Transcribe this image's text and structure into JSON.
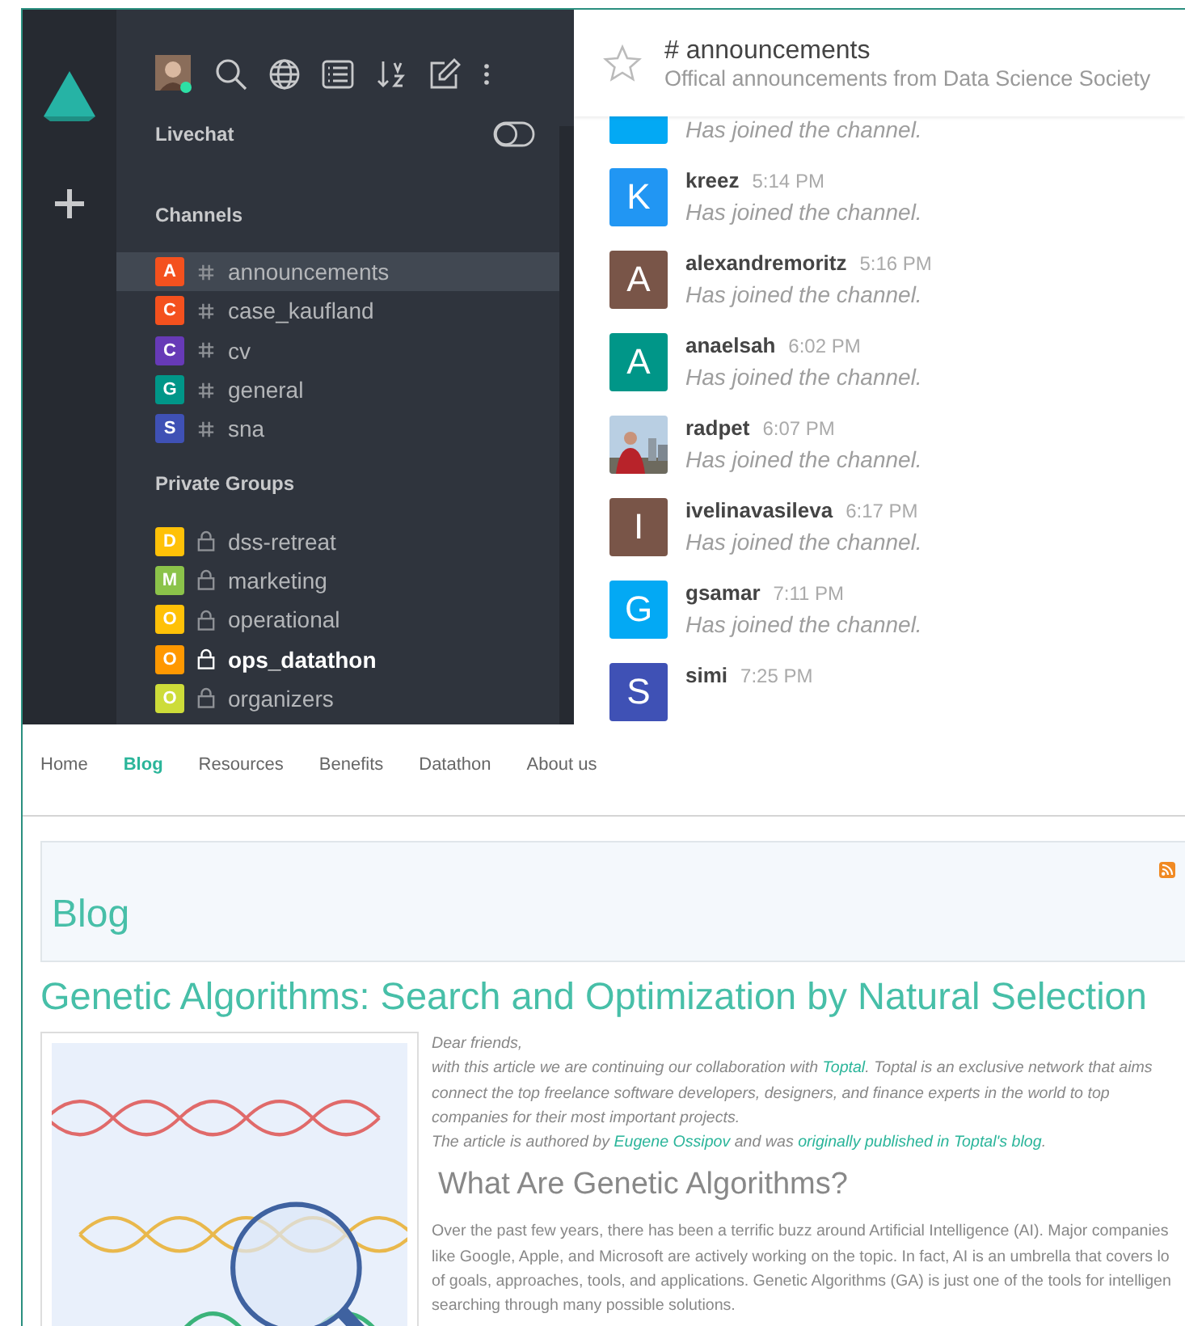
{
  "sidebar": {
    "livechat": {
      "label": "Livechat",
      "on": false
    },
    "sections": [
      {
        "title": "Channels",
        "kind": "channel",
        "items": [
          {
            "badge": "A",
            "name": "announcements",
            "color": "#f4511e",
            "selected": true,
            "unread": false
          },
          {
            "badge": "C",
            "name": "case_kaufland",
            "color": "#f4511e",
            "selected": false,
            "unread": false
          },
          {
            "badge": "C",
            "name": "cv",
            "color": "#673ab7",
            "selected": false,
            "unread": false
          },
          {
            "badge": "G",
            "name": "general",
            "color": "#009688",
            "selected": false,
            "unread": false
          },
          {
            "badge": "S",
            "name": "sna",
            "color": "#3f51b5",
            "selected": false,
            "unread": false
          }
        ]
      },
      {
        "title": "Private Groups",
        "kind": "private",
        "items": [
          {
            "badge": "D",
            "name": "dss-retreat",
            "color": "#ffc107",
            "selected": false,
            "unread": false
          },
          {
            "badge": "M",
            "name": "marketing",
            "color": "#8bc34a",
            "selected": false,
            "unread": false
          },
          {
            "badge": "O",
            "name": "operational",
            "color": "#ffc107",
            "selected": false,
            "unread": false
          },
          {
            "badge": "O",
            "name": "ops_datathon",
            "color": "#ff9800",
            "selected": false,
            "unread": true
          },
          {
            "badge": "O",
            "name": "organizers",
            "color": "#cddc39",
            "selected": false,
            "unread": false
          }
        ]
      }
    ]
  },
  "header": {
    "title": "# announcements",
    "topic": "Offical announcements from Data Science Society",
    "starred": false
  },
  "messages": [
    {
      "kind": "letter",
      "color": "#03a9f4",
      "text": "Has joined the channel."
    },
    {
      "kind": "letter",
      "initial": "K",
      "color": "#2196f3",
      "name": "kreez",
      "time": "5:14 PM",
      "text": "Has joined the channel."
    },
    {
      "kind": "letter",
      "initial": "A",
      "color": "#795548",
      "name": "alexandremoritz",
      "time": "5:16 PM",
      "text": "Has joined the channel."
    },
    {
      "kind": "letter",
      "initial": "A",
      "color": "#009688",
      "name": "anaelsah",
      "time": "6:02 PM",
      "text": "Has joined the channel."
    },
    {
      "kind": "picture",
      "name": "radpet",
      "time": "6:07 PM",
      "text": "Has joined the channel."
    },
    {
      "kind": "letter",
      "initial": "I",
      "color": "#795548",
      "name": "ivelinavasileva",
      "time": "6:17 PM",
      "text": "Has joined the channel."
    },
    {
      "kind": "letter",
      "initial": "G",
      "color": "#03a9f4",
      "name": "gsamar",
      "time": "7:11 PM",
      "text": "Has joined the channel."
    },
    {
      "kind": "letter",
      "initial": "S",
      "color": "#3f51b5",
      "name": "simi",
      "time": "7:25 PM"
    }
  ],
  "website": {
    "nav": [
      {
        "label": "Home",
        "selected": false
      },
      {
        "label": "Blog",
        "selected": true
      },
      {
        "label": "Resources",
        "selected": false
      },
      {
        "label": "Benefits",
        "selected": false
      },
      {
        "label": "Datathon",
        "selected": false
      },
      {
        "label": "About us",
        "selected": false
      }
    ],
    "banner": {
      "title": "Blog"
    },
    "article": {
      "title": "Genetic Algorithms: Search and Optimization by Natural Selection",
      "intro": [
        [
          {
            "text": "Dear friends,",
            "link": false
          }
        ],
        [
          {
            "text": "with this article we are continuing our collaboration with ",
            "link": false
          },
          {
            "text": "Toptal",
            "link": true
          },
          {
            "text": ". Toptal is an exclusive network that aims",
            "link": false
          }
        ],
        [
          {
            "text": "connect the top freelance software developers, designers, and finance experts in the world to top",
            "link": false
          }
        ],
        [
          {
            "text": "companies for their most important projects.",
            "link": false
          }
        ],
        [
          {
            "text": "The article is authored by ",
            "link": false
          },
          {
            "text": "Eugene Ossipov",
            "link": true
          },
          {
            "text": " and was ",
            "link": false
          },
          {
            "text": "originally published in Toptal's blog",
            "link": true
          },
          {
            "text": ".",
            "link": false
          }
        ]
      ],
      "heading": "What Are Genetic Algorithms?",
      "body": [
        "Over the past few years, there has been a terrific buzz around Artificial Intelligence (AI). Major companies",
        "like Google, Apple, and Microsoft are actively working on the topic. In fact, AI is an umbrella that covers lo",
        "of goals, approaches, tools, and applications. Genetic Algorithms (GA) is just one of the tools for intelligen",
        "searching through many possible solutions."
      ]
    }
  }
}
